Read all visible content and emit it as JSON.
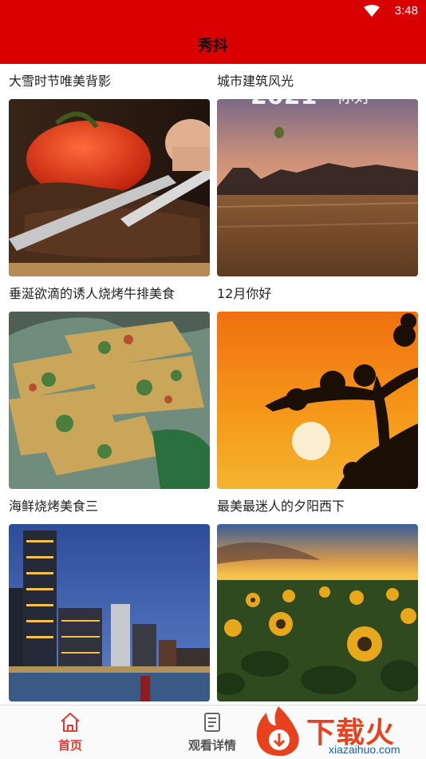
{
  "status_bar": {
    "time": "3:48",
    "wifi_icon": "wifi-icon"
  },
  "app_bar": {
    "title": "秀抖"
  },
  "cards": [
    {
      "caption": "大雪时节唯美背影",
      "image": "steak-tomato-photo"
    },
    {
      "caption": "城市建筑风光",
      "image": "wheat-field-sunset-photo"
    },
    {
      "caption": "垂涎欲滴的诱人烧烤牛排美食",
      "image": "fried-fish-photo"
    },
    {
      "caption": "12月你好",
      "image": "sunset-tree-photo"
    },
    {
      "caption": "海鲜烧烤美食三",
      "image": "city-night-photo"
    },
    {
      "caption": "最美最迷人的夕阳西下",
      "image": "sunflower-field-photo"
    }
  ],
  "tab_bar": {
    "tabs": [
      {
        "label": "首页",
        "icon": "home-icon",
        "active": true,
        "color": "#e53935"
      },
      {
        "label": "观看详情",
        "icon": "document-icon",
        "active": false,
        "color": "#555555"
      }
    ]
  },
  "watermark": {
    "text": "下载火",
    "url": "xiazaihuo.com"
  },
  "colors": {
    "accent": "#d80000"
  }
}
